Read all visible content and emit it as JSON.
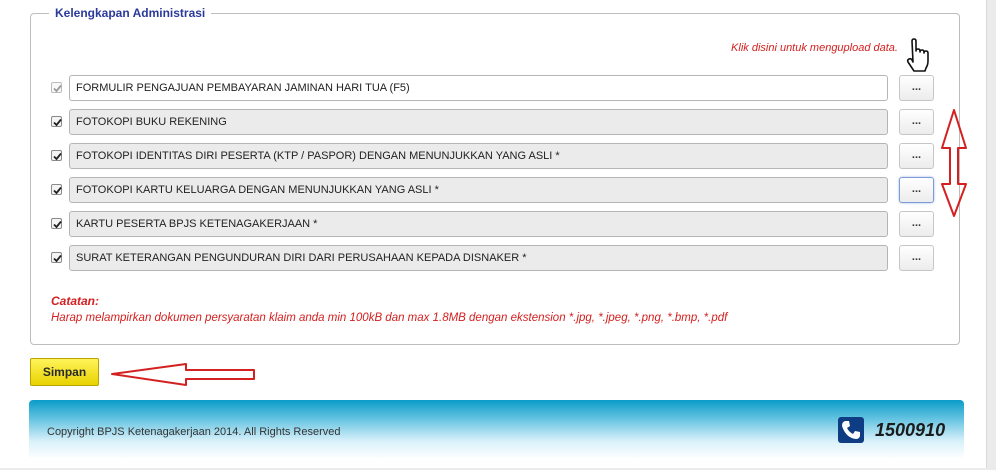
{
  "section": {
    "legend": "Kelengkapan Administrasi",
    "upload_hint": "Klik disini untuk mengupload data."
  },
  "documents": [
    {
      "label": "FORMULIR PENGAJUAN PEMBAYARAN JAMINAN HARI TUA (F5)",
      "checked": true,
      "disabled": true,
      "button": "..."
    },
    {
      "label": "FOTOKOPI BUKU REKENING",
      "checked": true,
      "disabled": false,
      "button": "..."
    },
    {
      "label": "FOTOKOPI IDENTITAS DIRI PESERTA (KTP / PASPOR) DENGAN MENUNJUKKAN YANG ASLI *",
      "checked": true,
      "disabled": false,
      "button": "..."
    },
    {
      "label": "FOTOKOPI KARTU KELUARGA DENGAN MENUNJUKKAN YANG ASLI *",
      "checked": true,
      "disabled": false,
      "button": "..."
    },
    {
      "label": "KARTU PESERTA BPJS KETENAGAKERJAAN *",
      "checked": true,
      "disabled": false,
      "button": "..."
    },
    {
      "label": "SURAT KETERANGAN PENGUNDURAN DIRI DARI PERUSAHAAN KEPADA DISNAKER *",
      "checked": true,
      "disabled": false,
      "button": "..."
    }
  ],
  "note": {
    "title": "Catatan:",
    "text": "Harap melampirkan dokumen persyaratan klaim anda min 100kB dan max 1.8MB dengan ekstension *.jpg, *.jpeg, *.png, *.bmp, *.pdf"
  },
  "save_button": "Simpan",
  "footer": {
    "copyright": "Copyright BPJS Ketenagakerjaan 2014. All Rights Reserved",
    "phone": "1500910"
  },
  "colors": {
    "accent_red": "#d42020",
    "legend_blue": "#2b3a9a",
    "save_yellow": "#f0dc10",
    "footer_blue": "#0a9cc8",
    "phone_icon_bg": "#0f3d83"
  },
  "icons": {
    "hint": "pointing-hand-cursor-icon",
    "footer": "phone-icon",
    "annotations": "red-arrow-icon"
  }
}
